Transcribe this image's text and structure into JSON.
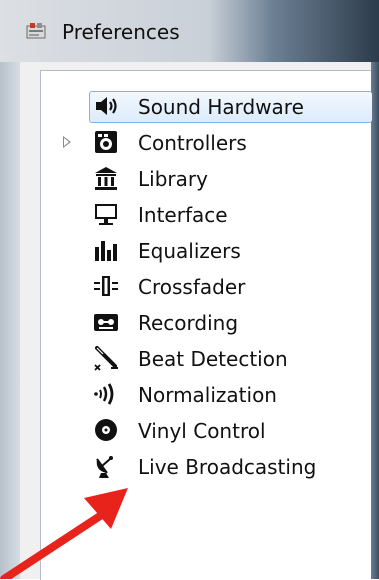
{
  "window": {
    "title": "Preferences",
    "icon": "preferences-app-icon"
  },
  "tree": {
    "items": [
      {
        "label": "Sound Hardware",
        "icon": "speaker-icon",
        "selected": true,
        "expandable": false
      },
      {
        "label": "Controllers",
        "icon": "controller-icon",
        "selected": false,
        "expandable": true
      },
      {
        "label": "Library",
        "icon": "library-icon",
        "selected": false,
        "expandable": false
      },
      {
        "label": "Interface",
        "icon": "monitor-icon",
        "selected": false,
        "expandable": false
      },
      {
        "label": "Equalizers",
        "icon": "equalizer-icon",
        "selected": false,
        "expandable": false
      },
      {
        "label": "Crossfader",
        "icon": "crossfader-icon",
        "selected": false,
        "expandable": false
      },
      {
        "label": "Recording",
        "icon": "recording-icon",
        "selected": false,
        "expandable": false
      },
      {
        "label": "Beat Detection",
        "icon": "beat-detection-icon",
        "selected": false,
        "expandable": false
      },
      {
        "label": "Normalization",
        "icon": "normalization-icon",
        "selected": false,
        "expandable": false
      },
      {
        "label": "Vinyl Control",
        "icon": "vinyl-icon",
        "selected": false,
        "expandable": false
      },
      {
        "label": "Live Broadcasting",
        "icon": "satellite-dish-icon",
        "selected": false,
        "expandable": false
      }
    ]
  },
  "annotation": {
    "arrow_color": "#e8231c",
    "points_to": "Live Broadcasting"
  },
  "colors": {
    "selection_fill": "#dcebfc",
    "selection_border": "#7eb4ea"
  }
}
